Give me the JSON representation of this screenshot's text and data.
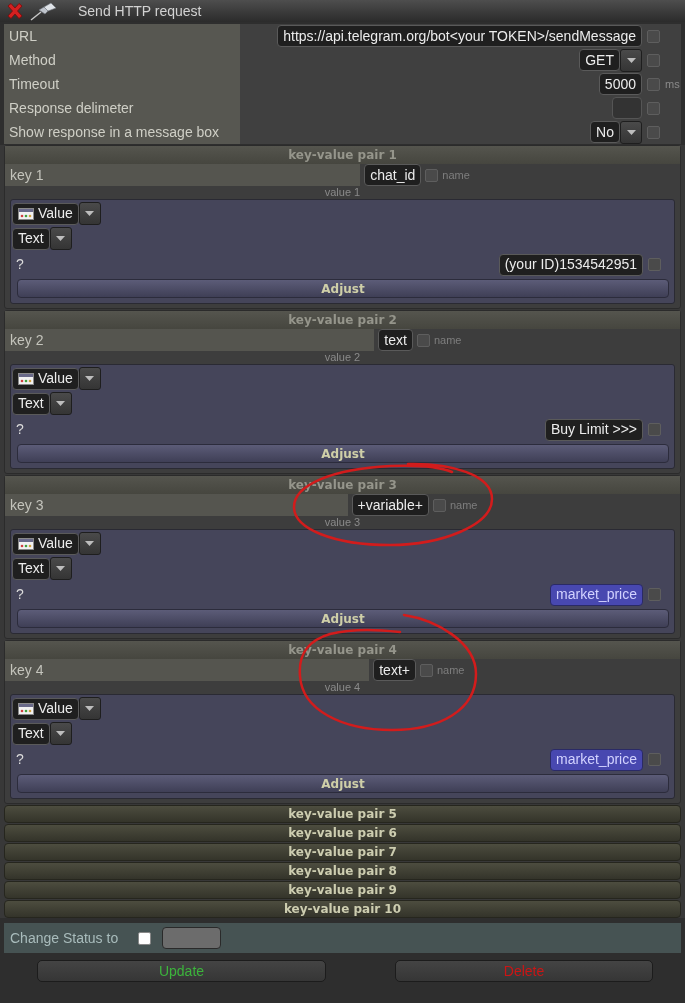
{
  "window": {
    "title": "Send HTTP request"
  },
  "properties": [
    {
      "label": "URL",
      "kind": "input",
      "value": "https://api.telegram.org/bot<your TOKEN>/sendMessage",
      "checked": false
    },
    {
      "label": "Method",
      "kind": "select",
      "value": "GET",
      "checked": false
    },
    {
      "label": "Timeout",
      "kind": "input",
      "value": "5000",
      "unit": "ms",
      "checked": false
    },
    {
      "label": "Response delimeter",
      "kind": "input",
      "checked": false
    },
    {
      "label": "Show response in a message box",
      "kind": "select",
      "value": "No",
      "checked": false
    }
  ],
  "pairs": [
    {
      "title": "key-value pair 1",
      "expanded": true,
      "key_label": "key 1",
      "key_value": "chat_id",
      "key_checked": false,
      "key_hint": "name",
      "value_label": "value 1",
      "source": "Value",
      "type": "Text",
      "question": "?",
      "value": {
        "kind": "text",
        "text": "(your ID)1534542951",
        "checked": false
      },
      "button": "Adjust"
    },
    {
      "title": "key-value pair 2",
      "expanded": true,
      "key_label": "key 2",
      "key_value": "text",
      "key_checked": false,
      "key_hint": "name",
      "value_label": "value 2",
      "source": "Value",
      "type": "Text",
      "question": "?",
      "value": {
        "kind": "text",
        "text": "Buy Limit >>>",
        "checked": false
      },
      "button": "Adjust"
    },
    {
      "title": "key-value pair 3",
      "expanded": true,
      "key_label": "key 3",
      "key_value": "+variable+",
      "key_checked": false,
      "key_hint": "name",
      "value_label": "value 3",
      "source": "Value",
      "type": "Text",
      "question": "?",
      "value": {
        "kind": "variable",
        "text": "market_price",
        "checked": false
      },
      "button": "Adjust"
    },
    {
      "title": "key-value pair 4",
      "expanded": true,
      "key_label": "key 4",
      "key_value": "text+",
      "key_checked": false,
      "key_hint": "name",
      "value_label": "value 4",
      "source": "Value",
      "type": "Text",
      "question": "?",
      "value": {
        "kind": "variable",
        "text": "market_price",
        "checked": false
      },
      "button": "Adjust"
    },
    {
      "title": "key-value pair 5",
      "expanded": false
    },
    {
      "title": "key-value pair 6",
      "expanded": false
    },
    {
      "title": "key-value pair 7",
      "expanded": false
    },
    {
      "title": "key-value pair 8",
      "expanded": false
    },
    {
      "title": "key-value pair 9",
      "expanded": false
    },
    {
      "title": "key-value pair 10",
      "expanded": false
    }
  ],
  "status": {
    "label": "Change Status to",
    "checked": false
  },
  "buttons": [
    {
      "label": "Update",
      "kind": "update"
    },
    {
      "label": "Delete",
      "kind": "delete"
    }
  ]
}
